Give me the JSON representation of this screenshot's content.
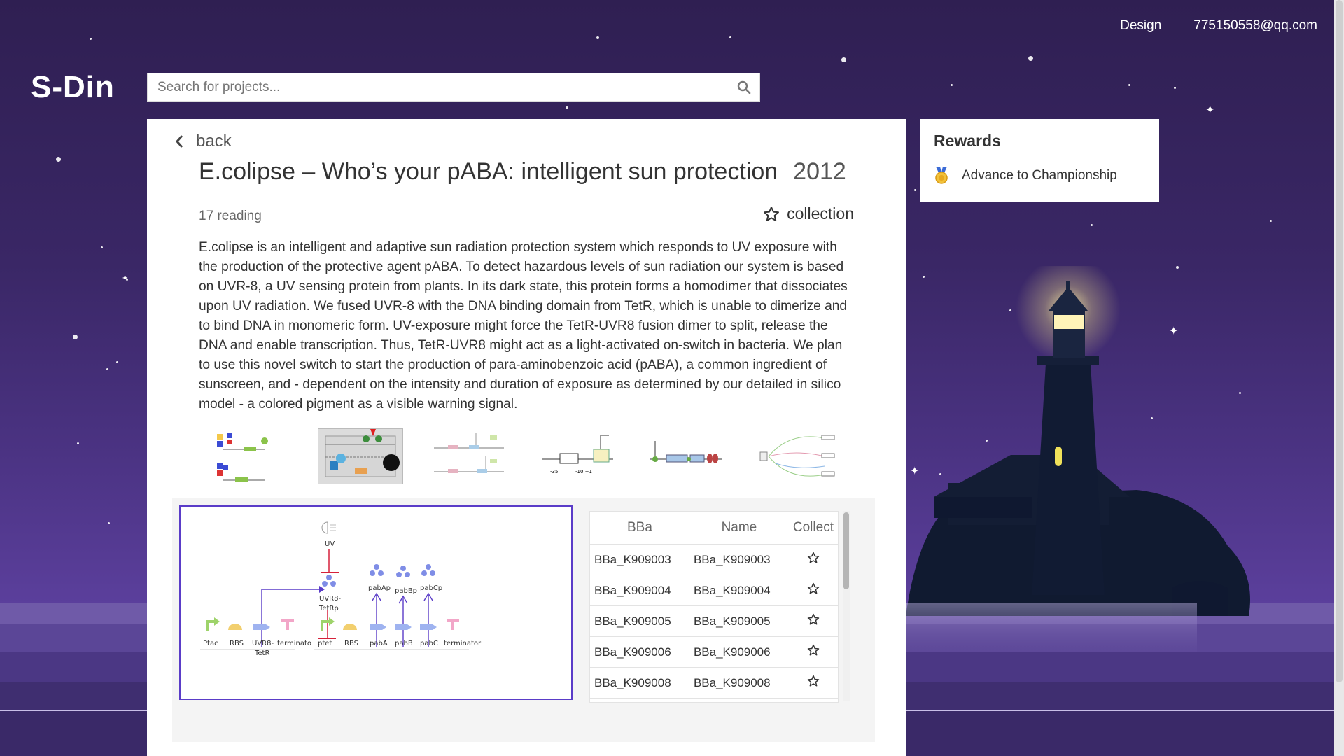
{
  "nav": {
    "design": "Design",
    "account": "775150558@qq.com"
  },
  "logo": "S-Din",
  "search": {
    "placeholder": "Search for projects..."
  },
  "project": {
    "back_label": "back",
    "title": "E.colipse – Who’s your pABA: intelligent sun protection",
    "year": "2012",
    "reading": "17 reading",
    "collection_label": "collection",
    "description": "E.colipse is an intelligent and adaptive sun radiation protection system which responds to UV exposure with the production of the protective agent pABA. To detect hazardous levels of sun radiation our system is based on UVR-8, a UV sensing protein from plants. In its dark state, this protein forms a homodimer that dissociates upon UV radiation. We fused UVR-8 with the DNA binding domain from TetR, which is unable to dimerize and to bind DNA in monomeric form. UV-exposure might force the TetR-UVR8 fusion dimer to split, release the DNA and enable transcription. Thus, TetR-UVR8 might act as a light-activated on-switch in bacteria. We plan to use this novel switch to start the production of para-aminobenzoic acid (pABA), a common ingredient of sunscreen, and - dependent on the intensity and duration of exposure as determined by our detailed in silico model - a colored pigment as a visible warning signal."
  },
  "circuit": {
    "uv": "UV",
    "complex": [
      "UVR8-",
      "TetRp"
    ],
    "products": [
      "pabAp",
      "pabBp",
      "pabCp"
    ],
    "parts": [
      "Ptac",
      "RBS",
      "UVR8-",
      "TetR",
      "terminato",
      "ptet",
      "RBS",
      "pabA",
      "pabB",
      "pabC",
      "terminator"
    ],
    "colors": {
      "promoter": "#9ed36a",
      "rbs": "#f2cf6e",
      "cds": "#9fb3f0",
      "terminator": "#f2a6c8",
      "repress": "#d6213a",
      "arrow": "#5a3cc8"
    }
  },
  "parts_table": {
    "headers": [
      "BBa",
      "Name",
      "Collect"
    ],
    "rows": [
      [
        "BBa_K909003",
        "BBa_K909003"
      ],
      [
        "BBa_K909004",
        "BBa_K909004"
      ],
      [
        "BBa_K909005",
        "BBa_K909005"
      ],
      [
        "BBa_K909006",
        "BBa_K909006"
      ],
      [
        "BBa_K909008",
        "BBa_K909008"
      ]
    ]
  },
  "rewards": {
    "title": "Rewards",
    "items": [
      "Advance to Championship"
    ]
  }
}
